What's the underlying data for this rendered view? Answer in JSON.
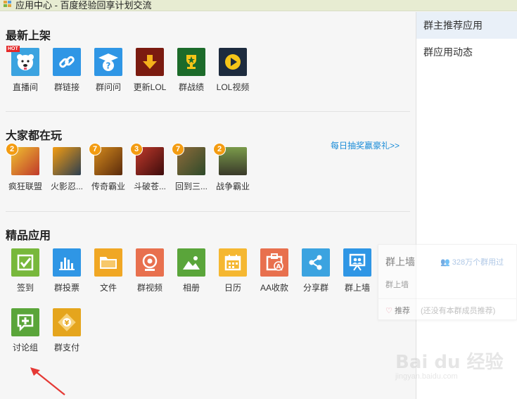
{
  "title_bar": {
    "title": "应用中心 - 百度经验回享计划交流"
  },
  "sections": {
    "new": {
      "title": "最新上架"
    },
    "popular": {
      "title": "大家都在玩",
      "promo_link": "每日抽奖赢豪礼>>"
    },
    "featured": {
      "title": "精品应用"
    }
  },
  "new_apps": [
    {
      "label": "直播间",
      "icon": "dog-face-icon",
      "hot": "HOT"
    },
    {
      "label": "群链接",
      "icon": "link-icon"
    },
    {
      "label": "群问问",
      "icon": "question-cap-icon"
    },
    {
      "label": "更新LOL",
      "icon": "download-arrow-icon"
    },
    {
      "label": "群战绩",
      "icon": "trophy-icon"
    },
    {
      "label": "LOL视频",
      "icon": "play-icon"
    }
  ],
  "games": [
    {
      "label": "疯狂联盟",
      "badge": "2"
    },
    {
      "label": "火影忍...",
      "badge": ""
    },
    {
      "label": "传奇霸业",
      "badge": "7"
    },
    {
      "label": "斗破苍...",
      "badge": "3"
    },
    {
      "label": "回到三...",
      "badge": "7"
    },
    {
      "label": "战争霸业",
      "badge": "2"
    }
  ],
  "featured_apps": [
    {
      "label": "签到",
      "icon": "checkbox-icon"
    },
    {
      "label": "群投票",
      "icon": "bar-chart-icon"
    },
    {
      "label": "文件",
      "icon": "folder-icon"
    },
    {
      "label": "群视频",
      "icon": "webcam-icon"
    },
    {
      "label": "相册",
      "icon": "picture-icon"
    },
    {
      "label": "日历",
      "icon": "calendar-icon"
    },
    {
      "label": "AA收款",
      "icon": "aa-payment-icon"
    },
    {
      "label": "分享群",
      "icon": "share-icon"
    },
    {
      "label": "群上墙",
      "icon": "projector-icon"
    },
    {
      "label": "讨论组",
      "icon": "chat-plus-icon"
    },
    {
      "label": "群支付",
      "icon": "yuan-card-icon"
    }
  ],
  "sidebar": {
    "items": [
      {
        "label": "群主推荐应用"
      },
      {
        "label": "群应用动态"
      }
    ]
  },
  "popup": {
    "title": "群上墙",
    "count": "328万个群用过",
    "description": "群上墙",
    "recommend": "推荐",
    "note": "(还没有本群成员推荐)"
  },
  "watermark": {
    "main": "Bai du 经验",
    "sub": "jingyan.baidu.com"
  },
  "colors": {
    "link": "#1a8cd8",
    "badge": "#f39c12",
    "hot": "#e52a2a",
    "sidebar_active": "#e9f0f8"
  }
}
